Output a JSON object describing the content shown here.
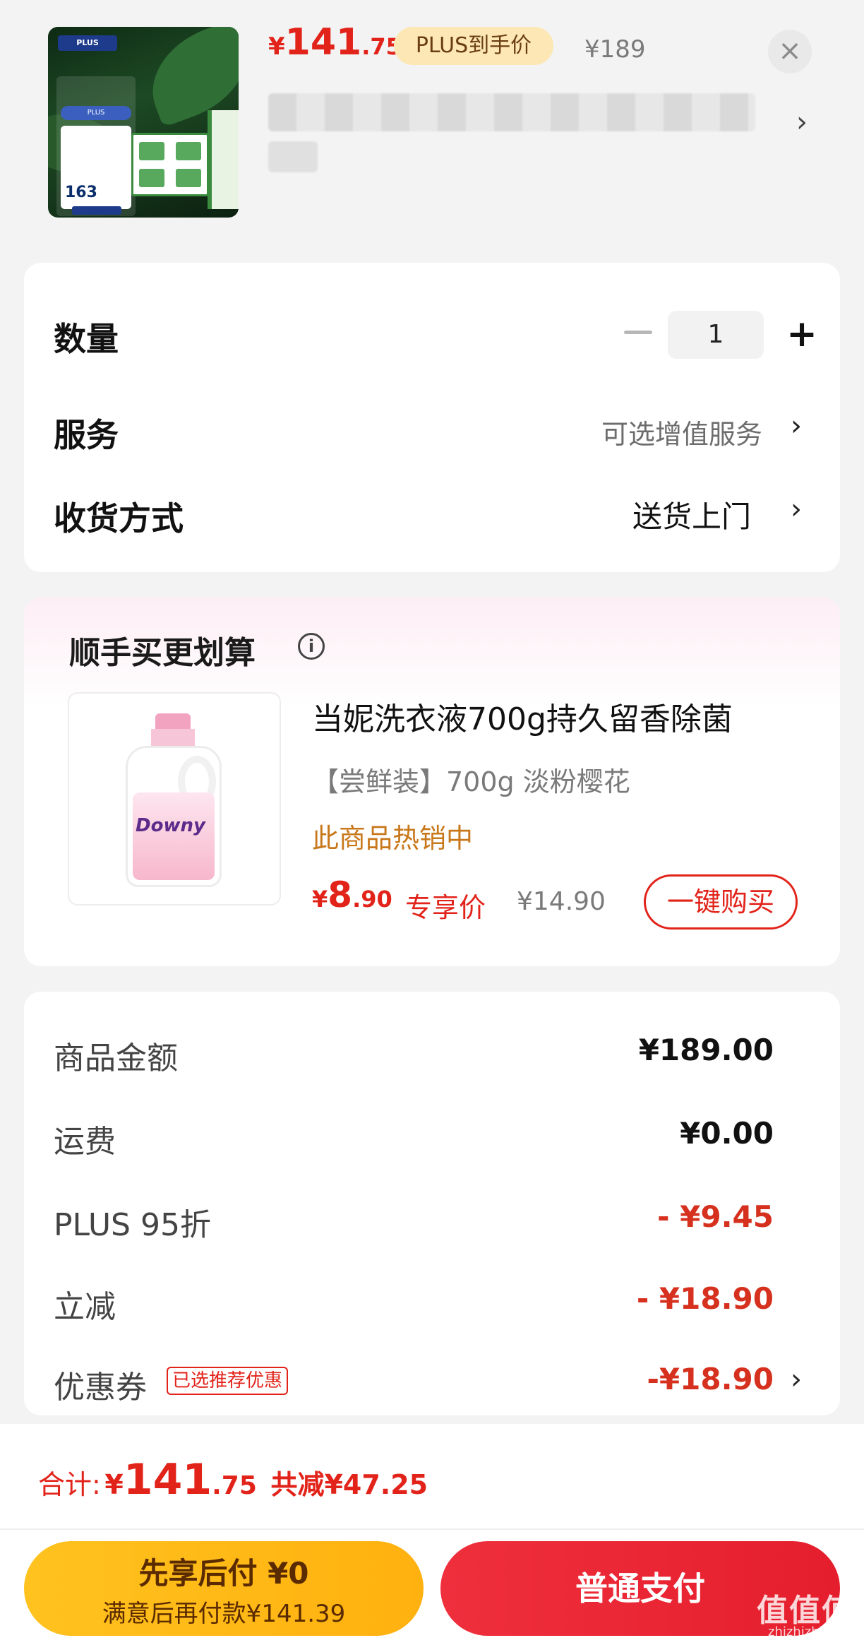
{
  "product": {
    "price_currency": "¥",
    "price_int": "141",
    "price_dec": ".75",
    "plus_badge": "PLUS到手价",
    "original_price": "¥189",
    "image_total_price": "163",
    "close_icon": "×",
    "spec_chevron": "›"
  },
  "options": {
    "quantity_label": "数量",
    "quantity_value": "1",
    "minus_icon": "−",
    "plus_icon": "+",
    "service_label": "服务",
    "service_value": "可选增值服务",
    "delivery_label": "收货方式",
    "delivery_value": "送货上门",
    "chevron": "›"
  },
  "addon": {
    "section_title": "顺手买更划算",
    "info_icon": "i",
    "title": "当妮洗衣液700g持久留香除菌",
    "spec": "【尝鲜装】700g 淡粉樱花",
    "hot_text": "此商品热销中",
    "price_currency": "¥",
    "price_int": "8",
    "price_dec": ".90",
    "price_tag": "专享价",
    "original_price": "¥14.90",
    "buy_button": "一键购买",
    "bottle_logo": "Downy"
  },
  "summary": {
    "goods_label": "商品金额",
    "goods_value": "¥189.00",
    "shipping_label": "运费",
    "shipping_value": "¥0.00",
    "plus_label": "PLUS 95折",
    "plus_value": "- ¥9.45",
    "discount_label": "立减",
    "discount_value": "- ¥18.90",
    "coupon_label": "优惠券",
    "coupon_tag": "已选推荐优惠",
    "coupon_value": "-¥18.90",
    "chevron": "›"
  },
  "bottom": {
    "total_label": "合计:",
    "total_currency": "¥",
    "total_int": "141",
    "total_dec": ".75",
    "total_saved": "共减¥47.25",
    "pay_later_title": "先享后付 ¥0",
    "pay_later_sub": "满意后再付款¥141.39",
    "pay_normal": "普通支付",
    "watermark": "值值值",
    "watermark_sub": "zhizhizhi.com"
  },
  "colors": {
    "accent_red": "#e2231a",
    "plus_gold": "#fde7b4",
    "pay_later_yellow": "#ffc21f",
    "pay_normal_red": "#ef2f3c"
  }
}
